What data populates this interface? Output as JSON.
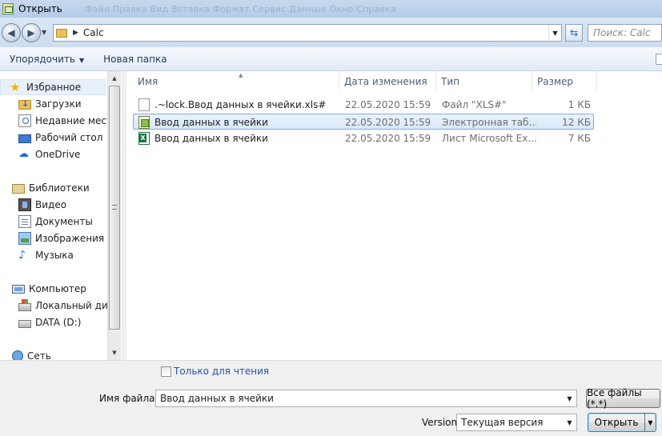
{
  "window": {
    "title": "Открыть",
    "menu_ghost": "Файл   Правка   Вид   Вставка   Формат   Сервис   Данные   Окно   Справка"
  },
  "address": {
    "path": "Calc",
    "search_placeholder": "Поиск: Calc"
  },
  "toolbar": {
    "organize": "Упорядочить",
    "new_folder": "Новая папка"
  },
  "nav": {
    "favorites": "Избранное",
    "downloads": "Загрузки",
    "recent": "Недавние места",
    "desktop": "Рабочий стол",
    "onedrive": "OneDrive",
    "libraries": "Библиотеки",
    "video": "Видео",
    "documents": "Документы",
    "images": "Изображения",
    "music": "Музыка",
    "computer": "Компьютер",
    "local_disk": "Локальный диск",
    "data_drive": "DATA (D:)",
    "network": "Сеть"
  },
  "columns": {
    "name": "Имя",
    "date": "Дата изменения",
    "type": "Тип",
    "size": "Размер"
  },
  "files": [
    {
      "name": ".~lock.Ввод  данных  в  ячейки.xls#",
      "date": "22.05.2020 15:59",
      "type": "Файл \"XLS#\"",
      "size": "1 КБ",
      "icon": "blank-file-icon"
    },
    {
      "name": "Ввод  данных  в  ячейки",
      "date": "22.05.2020 15:59",
      "type": "Электронная таб...",
      "size": "12 КБ",
      "icon": "calc-spreadsheet-icon"
    },
    {
      "name": "Ввод  данных  в  ячейки",
      "date": "22.05.2020 15:59",
      "type": "Лист Microsoft Ex...",
      "size": "7 КБ",
      "icon": "excel-file-icon"
    }
  ],
  "bottom": {
    "readonly_label": "Только для чтения",
    "filename_label": "Имя файла:",
    "filename_value": "Ввод  данных  в  ячейки",
    "filetype_value": "Все файлы (*.*)",
    "version_label": "Version",
    "version_value": "Текущая версия",
    "open_button": "Открыть"
  },
  "colors": {
    "selection_bg": "#d8e8fa",
    "selection_border": "#84acdd",
    "link_blue": "#2356a8"
  }
}
